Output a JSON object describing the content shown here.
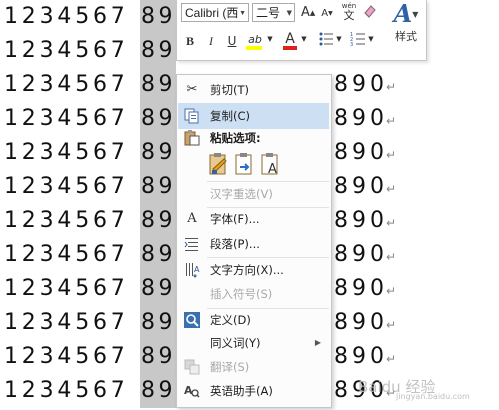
{
  "document": {
    "digits_left": "1234567",
    "digits_selected": "89",
    "digits_right": "890",
    "paragraph_mark": "↵",
    "line_count": 12
  },
  "mini_toolbar": {
    "font_name": "Calibri (西",
    "font_size": "二号",
    "grow_font": "A",
    "shrink_font": "A",
    "phonetic": "wén",
    "phonetic_char": "文",
    "bold": "B",
    "italic": "I",
    "underline": "U",
    "highlight": "ab",
    "font_color": "A",
    "styles_label": "样式",
    "highlight_color": "#ffff00",
    "font_color_value": "#e0201a"
  },
  "context_menu": {
    "items": [
      {
        "label": "剪切(T)",
        "icon": "scissors-icon",
        "enabled": true
      },
      {
        "label": "复制(C)",
        "icon": "copy-icon",
        "enabled": true,
        "highlighted": true
      },
      {
        "label": "粘贴选项:",
        "icon": "paste-icon",
        "enabled": true,
        "bold": true
      },
      {
        "label": "汉字重选(V)",
        "icon": "",
        "enabled": false
      },
      {
        "label": "字体(F)...",
        "icon": "font-icon",
        "enabled": true
      },
      {
        "label": "段落(P)...",
        "icon": "paragraph-icon",
        "enabled": true
      },
      {
        "label": "文字方向(X)...",
        "icon": "text-direction-icon",
        "enabled": true
      },
      {
        "label": "插入符号(S)",
        "icon": "",
        "enabled": false
      },
      {
        "label": "定义(D)",
        "icon": "define-icon",
        "enabled": true
      },
      {
        "label": "同义词(Y)",
        "icon": "",
        "enabled": true,
        "submenu": true
      },
      {
        "label": "翻译(S)",
        "icon": "translate-icon",
        "enabled": false
      },
      {
        "label": "英语助手(A)",
        "icon": "english-assistant-icon",
        "enabled": true
      }
    ],
    "paste_options": [
      "keep-source-formatting-icon",
      "merge-formatting-icon",
      "keep-text-only-icon"
    ]
  },
  "watermark": {
    "text": "Baidu 经验",
    "sub": "jingyan.baidu.com"
  }
}
